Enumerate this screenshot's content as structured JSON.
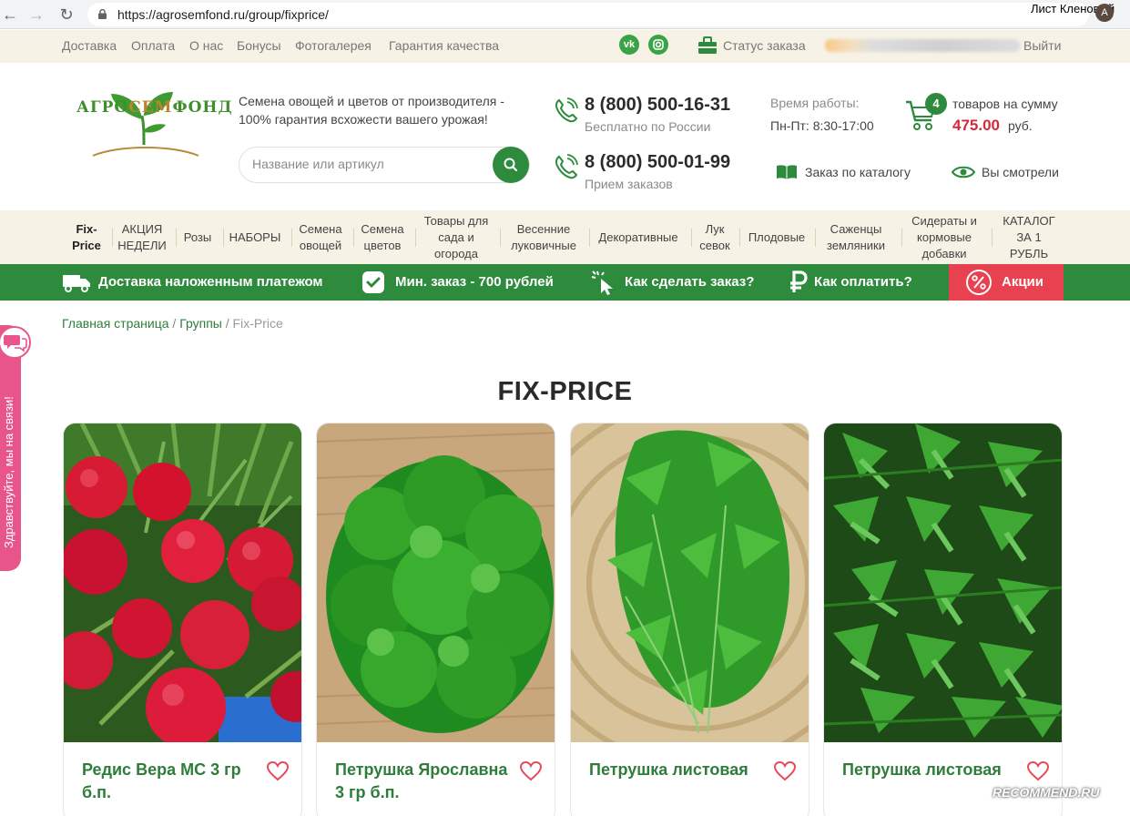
{
  "browser": {
    "back_icon": "arrow-left-icon",
    "forward_icon": "arrow-right-icon",
    "reload_icon": "reload-icon",
    "url": "https://agrosemfond.ru/group/fixprice/",
    "profile_name": "Лист Кленовый",
    "avatar_initial": "A"
  },
  "top_nav": {
    "links": [
      "Доставка",
      "Оплата",
      "О нас",
      "Бонусы",
      "Фотогалерея",
      "Гарантия качества"
    ],
    "vk_label": "vk",
    "order_status": "Статус заказа",
    "logout": "Выйти"
  },
  "header": {
    "logo_parts": [
      "АГРО",
      "СЕМ",
      "ФОНД"
    ],
    "tagline": "Семена овощей и цветов от производителя - 100% гарантия всхожести вашего урожая!",
    "search_placeholder": "Название или артикул",
    "phone1": "8 (800) 500-16-31",
    "phone1_note": "Бесплатно по России",
    "phone2": "8 (800) 500-01-99",
    "phone2_note": "Прием заказов",
    "work_label": "Время работы:",
    "work_hours": "Пн-Пт: 8:30-17:00",
    "cart_count": "4",
    "cart_text": "товаров на сумму",
    "cart_sum": "475.00",
    "cart_currency": "руб.",
    "catalog_order": "Заказ по каталогу",
    "viewed": "Вы смотрели"
  },
  "categories": [
    "Fix-Price",
    "АКЦИЯ НЕДЕЛИ",
    "Розы",
    "НАБОРЫ",
    "Семена овощей",
    "Семена цветов",
    "Товары для сада и огорода",
    "Весенние луковичные",
    "Декоративные",
    "Лук севок",
    "Плодовые",
    "Саженцы земляники",
    "Сидераты и кормовые добавки",
    "КАТАЛОГ ЗА 1 РУБЛЬ"
  ],
  "benefits": {
    "delivery": "Доставка наложенным платежом",
    "min_order": "Мин. заказ - 700 рублей",
    "how_to_order": "Как сделать заказ?",
    "how_to_pay": "Как оплатить?",
    "promo": "Акции"
  },
  "breadcrumb": {
    "home": "Главная страница",
    "groups": "Группы",
    "current": "Fix-Price"
  },
  "side_widget": {
    "text": "Здравствуйте, мы на связи!"
  },
  "page_title": "FIX-PRICE",
  "products": [
    {
      "title": "Редис Вера МС 3 гр б.п.",
      "image": "radish"
    },
    {
      "title": "Петрушка Ярославна 3 гр б.п.",
      "image": "curly-parsley"
    },
    {
      "title": "Петрушка листовая",
      "image": "leaf-parsley"
    },
    {
      "title": "Петрушка листовая",
      "image": "leaf-parsley-2"
    }
  ],
  "watermark": "RECOMMEND.RU",
  "colors": {
    "brand_green": "#2e8b3e",
    "accent_red": "#d22a3a",
    "promo_red": "#e8414f",
    "side_pink": "#e8558a",
    "beige": "#f7f2e6"
  }
}
